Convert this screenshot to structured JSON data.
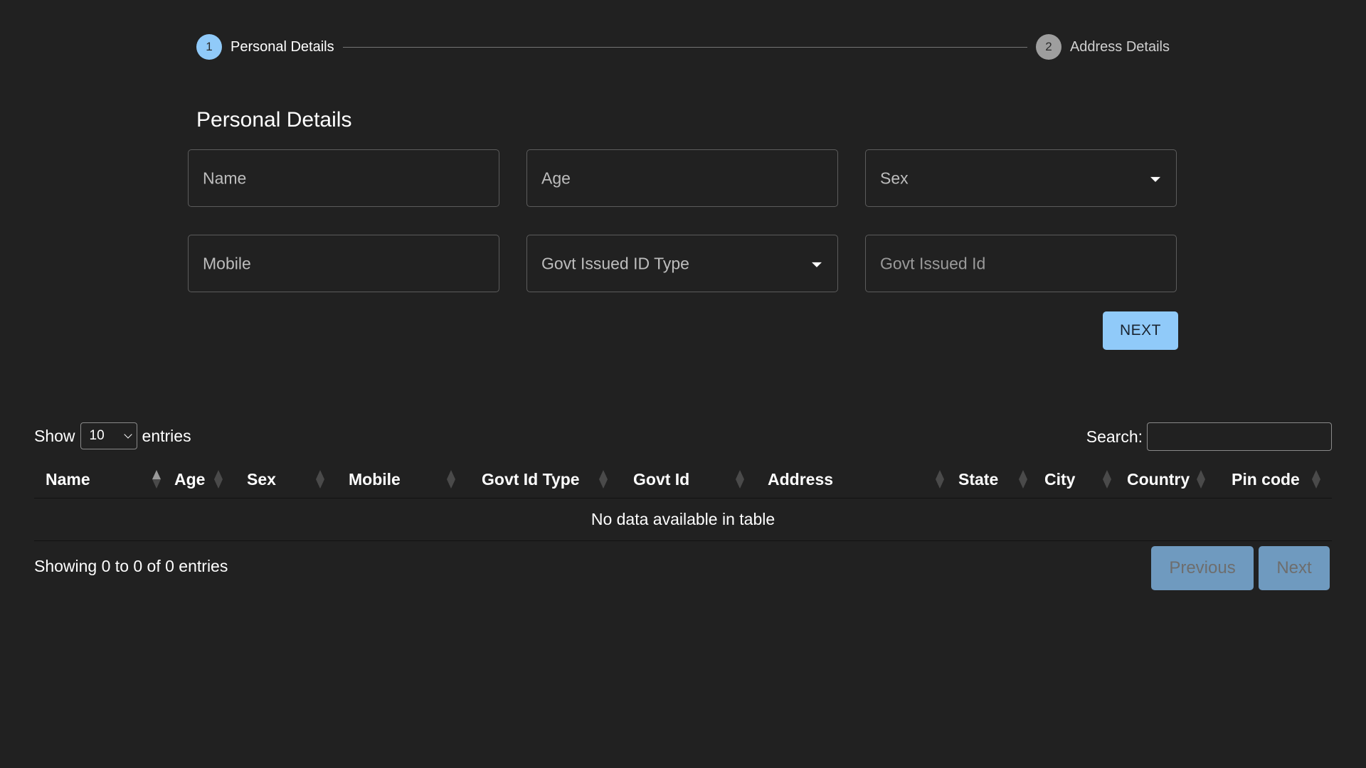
{
  "stepper": {
    "steps": [
      {
        "number": "1",
        "label": "Personal Details",
        "state": "active"
      },
      {
        "number": "2",
        "label": "Address Details",
        "state": "inactive"
      }
    ]
  },
  "form": {
    "title": "Personal Details",
    "fields": {
      "name": {
        "placeholder": "Name",
        "value": ""
      },
      "age": {
        "placeholder": "Age",
        "value": ""
      },
      "sex": {
        "label": "Sex",
        "type": "select",
        "selected": ""
      },
      "mobile": {
        "placeholder": "Mobile",
        "value": ""
      },
      "govt_id_type": {
        "label": "Govt Issued ID Type",
        "type": "select",
        "selected": ""
      },
      "govt_id": {
        "placeholder": "Govt Issued Id",
        "value": ""
      }
    },
    "next_label": "NEXT"
  },
  "table": {
    "length": {
      "prefix": "Show",
      "selected": "10",
      "suffix": "entries"
    },
    "search": {
      "label": "Search:",
      "value": ""
    },
    "columns": [
      "Name",
      "Age",
      "Sex",
      "Mobile",
      "Govt Id Type",
      "Govt Id",
      "Address",
      "State",
      "City",
      "Country",
      "Pin code"
    ],
    "sorted_column": "Name",
    "sort_direction": "ascending",
    "empty_message": "No data available in table",
    "info": "Showing 0 to 0 of 0 entries",
    "pagination": {
      "previous": "Previous",
      "next": "Next"
    }
  },
  "colors": {
    "background": "#212121",
    "accent": "#90caf9",
    "pagination_disabled": "#6f9abf"
  }
}
